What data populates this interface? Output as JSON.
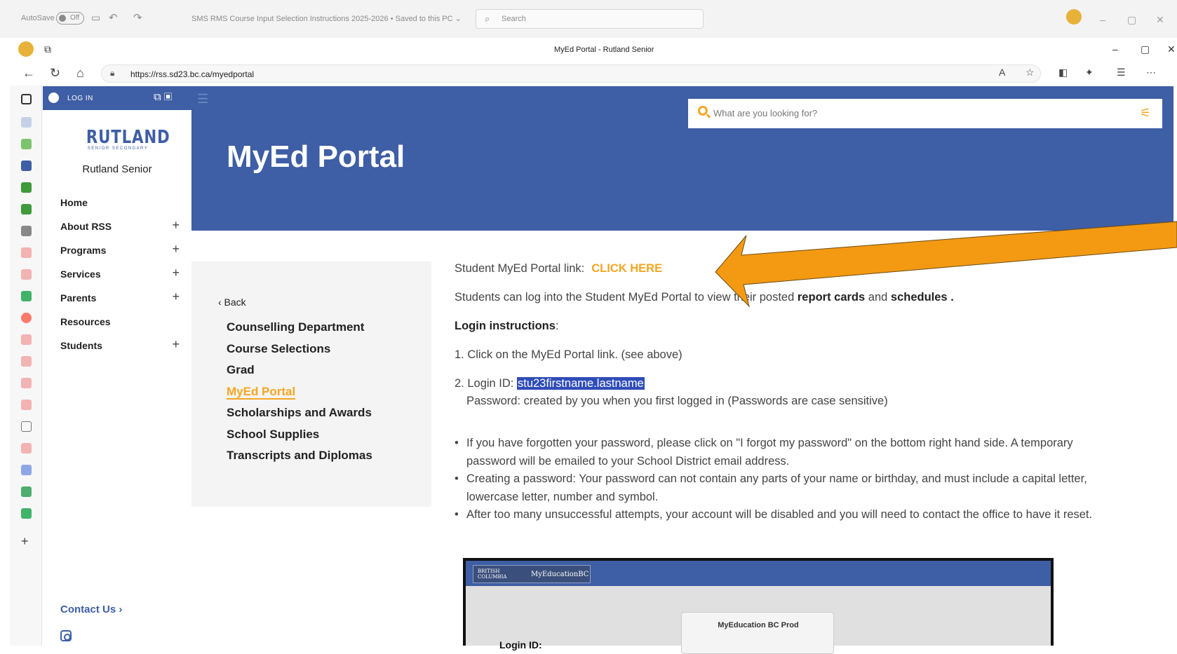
{
  "word_bar": {
    "autosave_label": "AutoSave",
    "toggle_state": "Off",
    "doc_title": "SMS RMS Course Input Selection Instructions 2025-2026 • Saved to this PC ⌄",
    "search_placeholder": "Search"
  },
  "browser": {
    "tab_title": "MyEd Portal - Rutland Senior",
    "url": "https://rss.sd23.bc.ca/myedportal"
  },
  "site": {
    "login_label": "LOG IN",
    "logo_text": "RUTLAND",
    "logo_subtext": "SENIOR SECONDARY",
    "school_name": "Rutland Senior",
    "menu": [
      {
        "label": "Home",
        "plus": ""
      },
      {
        "label": "About RSS",
        "plus": "+"
      },
      {
        "label": "Programs",
        "plus": "+"
      },
      {
        "label": "Services",
        "plus": "+"
      },
      {
        "label": "Parents",
        "plus": "+"
      },
      {
        "label": "Resources",
        "plus": ""
      },
      {
        "label": "Students",
        "plus": "+"
      }
    ],
    "contact_label": "Contact Us ›",
    "page_title": "MyEd Portal",
    "search_placeholder": "What are you looking for?"
  },
  "subnav": {
    "back_label": "‹ Back",
    "links": [
      "Counselling Department",
      "Course Selections",
      "Grad",
      "MyEd Portal",
      "Scholarships and Awards",
      "School Supplies",
      "Transcripts and Diplomas"
    ]
  },
  "content": {
    "portal_link_prefix": "Student MyEd Portal link:",
    "portal_link_label": "CLICK HERE",
    "intro_prefix": "Students can log into the Student MyEd Portal to view their posted",
    "intro_bold1": "report cards",
    "intro_and": "and",
    "intro_bold2": "schedules .",
    "login_heading": "Login instructions",
    "step1": "1. Click on the MyEd Portal link. (see above)",
    "step2_prefix": "2. Login ID:",
    "step2_id": "stu23firstname.lastname",
    "step2_password": "Password: created by you when you first logged in (Passwords are case sensitive)",
    "bullets": [
      "If you have forgotten your password, please click on \"I forgot my password\" on the bottom right hand side. A temporary password will be emailed to your School District email address.",
      "Creating a password: Your password can not contain any parts of your name or birthday, and must include a capital letter, lowercase letter, number and symbol.",
      "After too many unsuccessful attempts, your account will be disabled and you will need to contact the office to have it reset."
    ]
  },
  "embedded_screenshot": {
    "bc_label": "BRITISH COLUMBIA",
    "brand": "MyEducationBC",
    "prod_title": "MyEducation BC Prod",
    "login_label": "Login ID:"
  },
  "colors": {
    "brand_blue": "#3e5ea5",
    "accent_orange": "#f5a623",
    "selection_blue": "#2f4cb8"
  }
}
